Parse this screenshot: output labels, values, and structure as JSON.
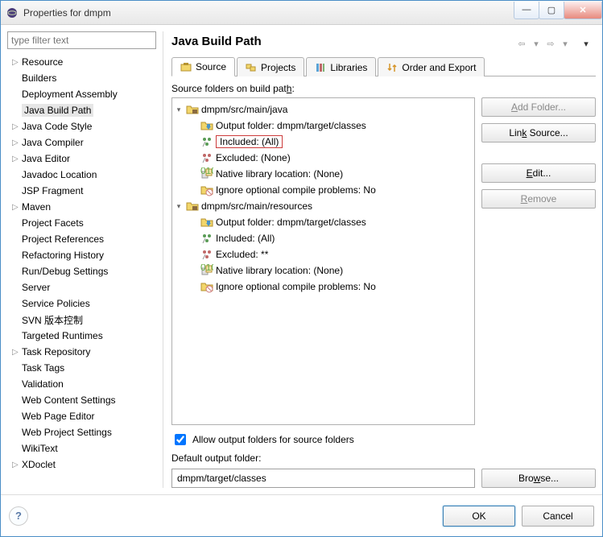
{
  "window": {
    "title": "Properties for dmpm",
    "min": "—",
    "max": "▢",
    "close": "✕"
  },
  "filter": {
    "placeholder": "type filter text"
  },
  "nav": [
    {
      "label": "Resource",
      "expandable": true
    },
    {
      "label": "Builders",
      "expandable": false
    },
    {
      "label": "Deployment Assembly",
      "expandable": false
    },
    {
      "label": "Java Build Path",
      "expandable": false,
      "selected": true
    },
    {
      "label": "Java Code Style",
      "expandable": true
    },
    {
      "label": "Java Compiler",
      "expandable": true
    },
    {
      "label": "Java Editor",
      "expandable": true
    },
    {
      "label": "Javadoc Location",
      "expandable": false
    },
    {
      "label": "JSP Fragment",
      "expandable": false
    },
    {
      "label": "Maven",
      "expandable": true
    },
    {
      "label": "Project Facets",
      "expandable": false
    },
    {
      "label": "Project References",
      "expandable": false
    },
    {
      "label": "Refactoring History",
      "expandable": false
    },
    {
      "label": "Run/Debug Settings",
      "expandable": false
    },
    {
      "label": "Server",
      "expandable": false
    },
    {
      "label": "Service Policies",
      "expandable": false
    },
    {
      "label": "SVN 版本控制",
      "expandable": false
    },
    {
      "label": "Targeted Runtimes",
      "expandable": false
    },
    {
      "label": "Task Repository",
      "expandable": true
    },
    {
      "label": "Task Tags",
      "expandable": false
    },
    {
      "label": "Validation",
      "expandable": false
    },
    {
      "label": "Web Content Settings",
      "expandable": false
    },
    {
      "label": "Web Page Editor",
      "expandable": false
    },
    {
      "label": "Web Project Settings",
      "expandable": false
    },
    {
      "label": "WikiText",
      "expandable": false
    },
    {
      "label": "XDoclet",
      "expandable": true
    }
  ],
  "page_title": "Java Build Path",
  "head_nav": {
    "back": "⇦",
    "back_menu": "▾",
    "fwd": "⇨",
    "fwd_menu": "▾",
    "menu": "▾"
  },
  "tabs": [
    {
      "label": "Source",
      "icon": "package-icon",
      "active": true
    },
    {
      "label": "Projects",
      "icon": "projects-icon"
    },
    {
      "label": "Libraries",
      "icon": "library-icon"
    },
    {
      "label": "Order and Export",
      "icon": "order-icon"
    }
  ],
  "sources_caption_prefix": "Source folders on build pat",
  "sources_caption_u": "h",
  "sources_caption_suffix": ":",
  "tree": [
    {
      "lvl": 1,
      "tw": "▾",
      "icon": "srcfolder-icon",
      "text": "dmpm/src/main/java"
    },
    {
      "lvl": 2,
      "icon": "output-icon",
      "text": "Output folder: dmpm/target/classes"
    },
    {
      "lvl": 2,
      "icon": "include-icon",
      "text": "Included: (All)",
      "hl": true
    },
    {
      "lvl": 2,
      "icon": "exclude-icon",
      "text": "Excluded: (None)"
    },
    {
      "lvl": 2,
      "icon": "native-icon",
      "text": "Native library location: (None)"
    },
    {
      "lvl": 2,
      "icon": "ignore-icon",
      "text": "Ignore optional compile problems: No"
    },
    {
      "lvl": 1,
      "tw": "▾",
      "icon": "srcfolder-icon",
      "text": "dmpm/src/main/resources"
    },
    {
      "lvl": 2,
      "icon": "output-icon",
      "text": "Output folder: dmpm/target/classes"
    },
    {
      "lvl": 2,
      "icon": "include-icon",
      "text": "Included: (All)"
    },
    {
      "lvl": 2,
      "icon": "exclude-icon",
      "text": "Excluded: **"
    },
    {
      "lvl": 2,
      "icon": "native-icon",
      "text": "Native library location: (None)"
    },
    {
      "lvl": 2,
      "icon": "ignore-icon",
      "text": "Ignore optional compile problems: No"
    }
  ],
  "buttons": {
    "add": "Add Folder...",
    "link": "Link Source...",
    "edit": "Edit...",
    "remove": "Remove",
    "browse": "Browse..."
  },
  "allow_prefix": "Allow output folders for sour",
  "allow_u": "c",
  "allow_suffix": "e folders",
  "default_output_prefix": "Default output ",
  "default_output_u": "f",
  "default_output_suffix": "older:",
  "default_output_value": "dmpm/target/classes",
  "footer": {
    "ok": "OK",
    "cancel": "Cancel",
    "help": "?"
  }
}
